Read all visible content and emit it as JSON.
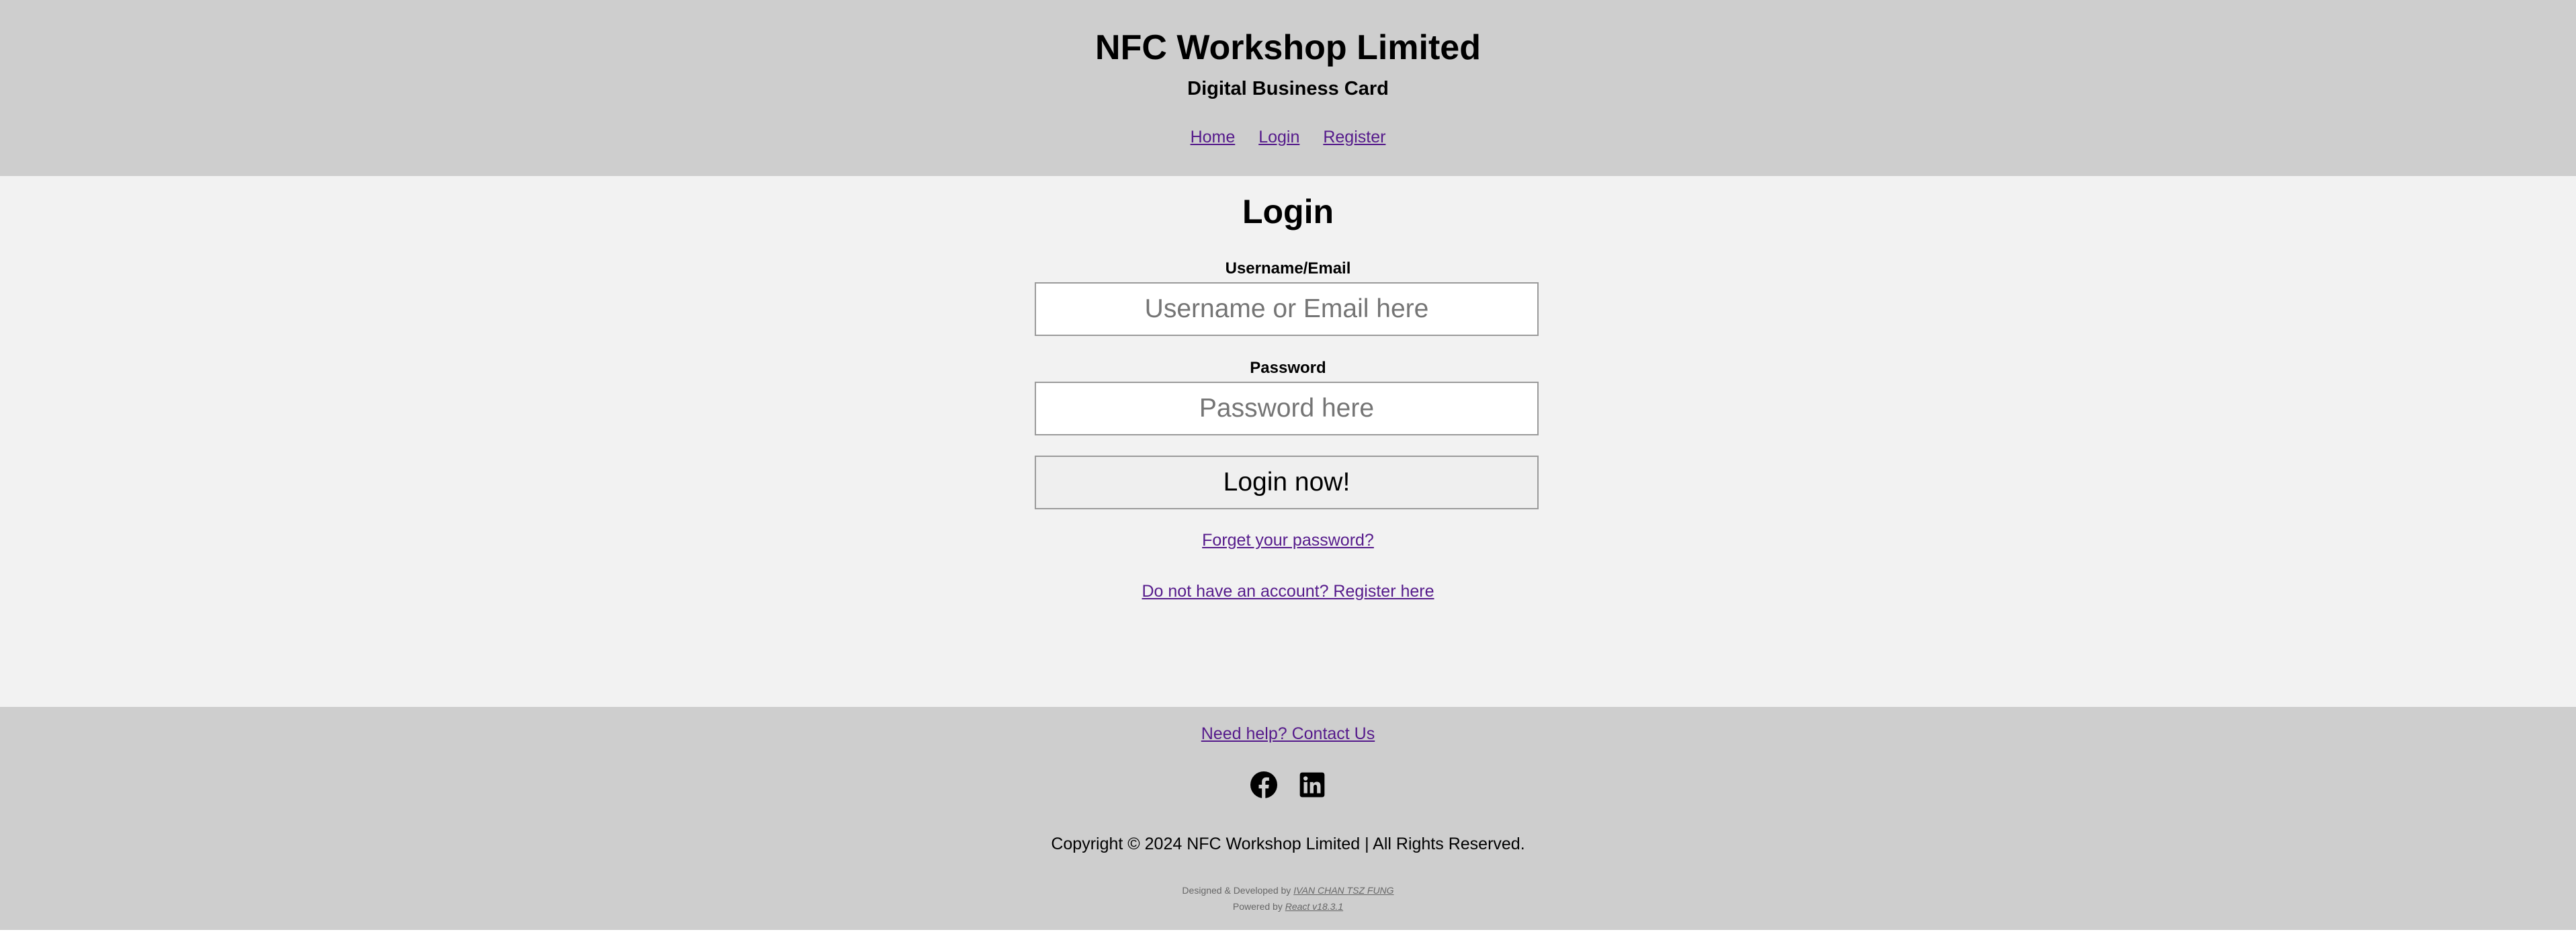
{
  "header": {
    "title": "NFC Workshop Limited",
    "subtitle": "Digital Business Card",
    "nav": {
      "home": "Home",
      "login": "Login",
      "register": "Register"
    }
  },
  "main": {
    "title": "Login",
    "username": {
      "label": "Username/Email",
      "placeholder": "Username or Email here",
      "value": ""
    },
    "password": {
      "label": "Password",
      "placeholder": "Password here",
      "value": ""
    },
    "submit_label": "Login now!",
    "forgot_link": "Forget your password?",
    "register_link": "Do not have an account? Register here"
  },
  "footer": {
    "help_link": "Need help? Contact Us",
    "social_icons": [
      "facebook-icon",
      "linkedin-icon"
    ],
    "copyright": "Copyright © 2024 NFC Workshop Limited | All Rights Reserved.",
    "designed_prefix": "Designed & Developed by",
    "designer_name": "IVAN CHAN TSZ FUNG",
    "powered_prefix": "Powered by",
    "powered_name": "React v18.3.1"
  },
  "colors": {
    "header_footer_bg": "#cecece",
    "main_bg": "#f2f2f2",
    "link": "#551a8b"
  }
}
